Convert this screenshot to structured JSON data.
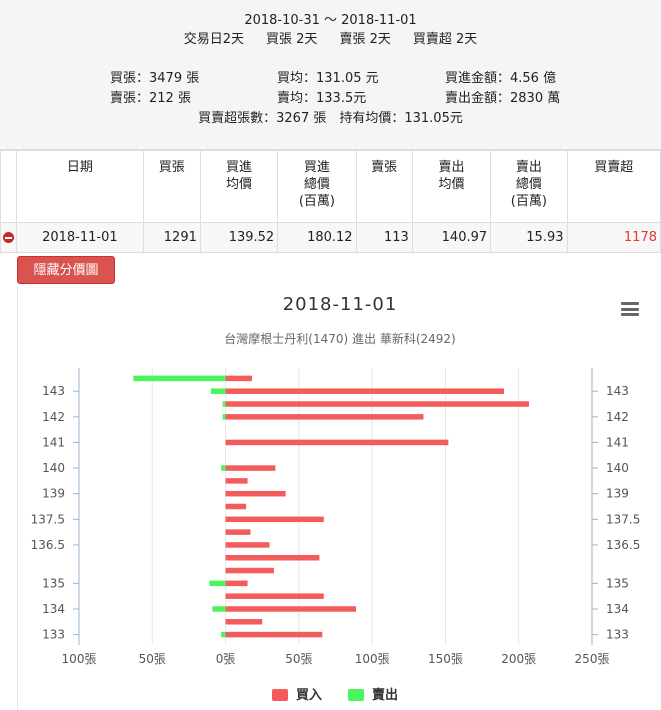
{
  "summary": {
    "date_range": "2018-10-31 ～ 2018-11-01",
    "days_line": [
      "交易日2天",
      "買張 2天",
      "賣張 2天",
      "買賣超 2天"
    ],
    "buy_qty": "買張：3479 張",
    "sell_qty": "賣張：212 張",
    "buy_avg": "買均：131.05 元",
    "sell_avg": "賣均：133.5元",
    "buy_amount": "買進金額：4.56 億",
    "sell_amount": "賣出金額：2830 萬",
    "net_line": "買賣超張數：3267 張　持有均價：131.05元"
  },
  "table": {
    "headers": [
      "",
      "日期",
      "買張",
      "買進\n均價",
      "買進\n總價\n(百萬)",
      "賣張",
      "賣出\n均價",
      "賣出\n總價\n(百萬)",
      "買賣超"
    ],
    "row": [
      "2018-11-01",
      "1291",
      "139.52",
      "180.12",
      "113",
      "140.97",
      "15.93",
      "1178"
    ]
  },
  "hide_button": "隱藏分價圖",
  "chart_data": {
    "type": "bar",
    "title": "2018-11-01",
    "subtitle": "台灣摩根士丹利(1470) 進出 華新科(2492)",
    "orientation": "horizontal",
    "categories": [
      "143.5",
      "143",
      "142.5",
      "142",
      "141.5",
      "141",
      "140.5",
      "140",
      "139.5",
      "139",
      "138",
      "137.5",
      "137",
      "136.5",
      "136",
      "135.5",
      "135",
      "134.5",
      "134",
      "133.5",
      "133"
    ],
    "category_tick_labels": [
      "143",
      "142",
      "141",
      "140",
      "139",
      "137.5",
      "136.5",
      "135",
      "134",
      "133"
    ],
    "xlabels": [
      "100張",
      "50張",
      "0張",
      "50張",
      "100張",
      "150張",
      "200張",
      "250張"
    ],
    "xlim": [
      -100,
      250
    ],
    "series": [
      {
        "name": "買入",
        "color": "#f45b5b",
        "values": [
          18,
          190,
          207,
          135,
          0,
          152,
          0,
          34,
          15,
          41,
          14,
          67,
          17,
          30,
          64,
          33,
          15,
          67,
          89,
          25,
          66
        ]
      },
      {
        "name": "賣出",
        "color": "#4af55b",
        "values": [
          63,
          10,
          2,
          2,
          0,
          0,
          0,
          3,
          0,
          0,
          0,
          0,
          0,
          0,
          0,
          0,
          11,
          0,
          9,
          0,
          3
        ]
      }
    ]
  }
}
